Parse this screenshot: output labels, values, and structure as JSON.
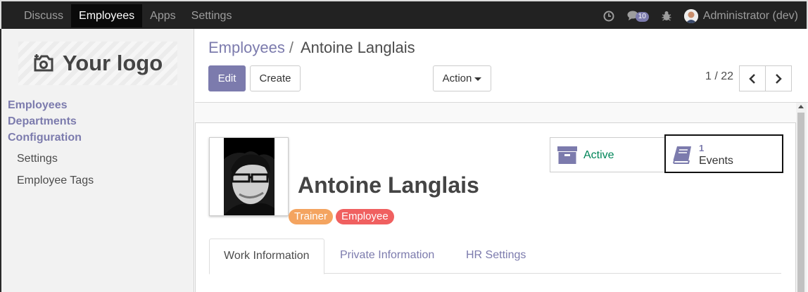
{
  "navbar": {
    "menu": [
      "Discuss",
      "Employees",
      "Apps",
      "Settings"
    ],
    "active": "Employees",
    "messages_count": "10",
    "user": "Administrator (dev)"
  },
  "sidebar": {
    "logo_text": "Your logo",
    "categories": [
      "Employees",
      "Departments",
      "Configuration"
    ],
    "config_items": [
      "Settings",
      "Employee Tags"
    ]
  },
  "breadcrumb": {
    "parent": "Employees",
    "separator": "/",
    "current": "Antoine Langlais"
  },
  "buttons": {
    "edit": "Edit",
    "create": "Create",
    "action": "Action"
  },
  "pager": {
    "value": "1 / 22"
  },
  "employee": {
    "name": "Antoine Langlais",
    "tags": [
      {
        "label": "Trainer",
        "color": "#f4a460"
      },
      {
        "label": "Employee",
        "color": "#f06060"
      }
    ]
  },
  "stat_buttons": {
    "active_label": "Active",
    "events_count": "1",
    "events_label": "Events"
  },
  "tabs": [
    "Work Information",
    "Private Information",
    "HR Settings"
  ],
  "colors": {
    "brand": "#7c7bad",
    "active_green": "#008558",
    "navbar_bg": "#222222"
  }
}
